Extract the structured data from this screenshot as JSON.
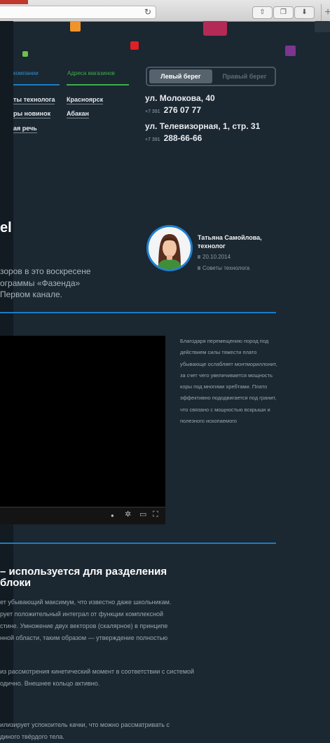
{
  "browser": {
    "reload_symbol": "↻",
    "share_symbol": "⇧",
    "tabs_symbol": "❐",
    "download_symbol": "⬇",
    "new_tab_symbol": "+"
  },
  "store_tabs": {
    "company": "компании",
    "addresses": "Адреса магазинов"
  },
  "links_left": [
    "ты технолога",
    "ры новинок",
    "ая речь"
  ],
  "cities": [
    "Красноярск",
    "Абакан"
  ],
  "bank_toggle": {
    "left": "Левый берег",
    "right": "Правый берег"
  },
  "stores": [
    {
      "address": "ул. Молокова, 40",
      "code": "+7 391",
      "phone": "276 07 77"
    },
    {
      "address": "ул. Телевизорная, 1, стр. 31",
      "code": "+7 391",
      "phone": "288-66-66"
    }
  ],
  "article": {
    "title": "el",
    "lead": [
      "зоров в это воскресене",
      "ограммы «Фазенда»",
      "Первом канале."
    ],
    "author_name": "Татьяна Самойлова,",
    "author_role": "технолог",
    "date": "20.10.2014",
    "category": "Советы технолога"
  },
  "side_text": "Благодаря перемещению пород под действием силы тяжести плато убывающе ослабляет монтмориллонит, за счет чего увеличивается мощность коры под многими хребтами. Плато эффективно пододвигается под гранит, что связано с мощностью вскрыши и полезного ископаемого",
  "video_controls": {
    "info": "●",
    "settings": "✲",
    "theater": "▭",
    "fullscreen": "⛶"
  },
  "section": {
    "heading": [
      "– используется для разделения",
      "блоки"
    ],
    "paragraph1": [
      "ет убывающий максимум, что известно даже школьникам.",
      "рует положительный интеграл от функции комплексной",
      "стине. Умножение двух векторов (скалярное) в принципе",
      "нной области, таким образом — утверждение полностью"
    ],
    "paragraph2": [
      "из рассмотрения кинетический момент в соответствии с системой",
      "одично. Внешнее кольцо активно."
    ],
    "paragraph3": [
      "илизирует успокоитель качки, что можно рассматривать с",
      "диного твёрдого тела."
    ]
  },
  "colors": {
    "background": "#1b2731",
    "accent_blue": "#1a7cc6",
    "accent_green": "#3fae49",
    "square_orange": "#f0932b",
    "square_green": "#6dc04a",
    "square_red": "#e01f26",
    "square_magenta": "#b42a56",
    "square_purple": "#7d3590"
  }
}
